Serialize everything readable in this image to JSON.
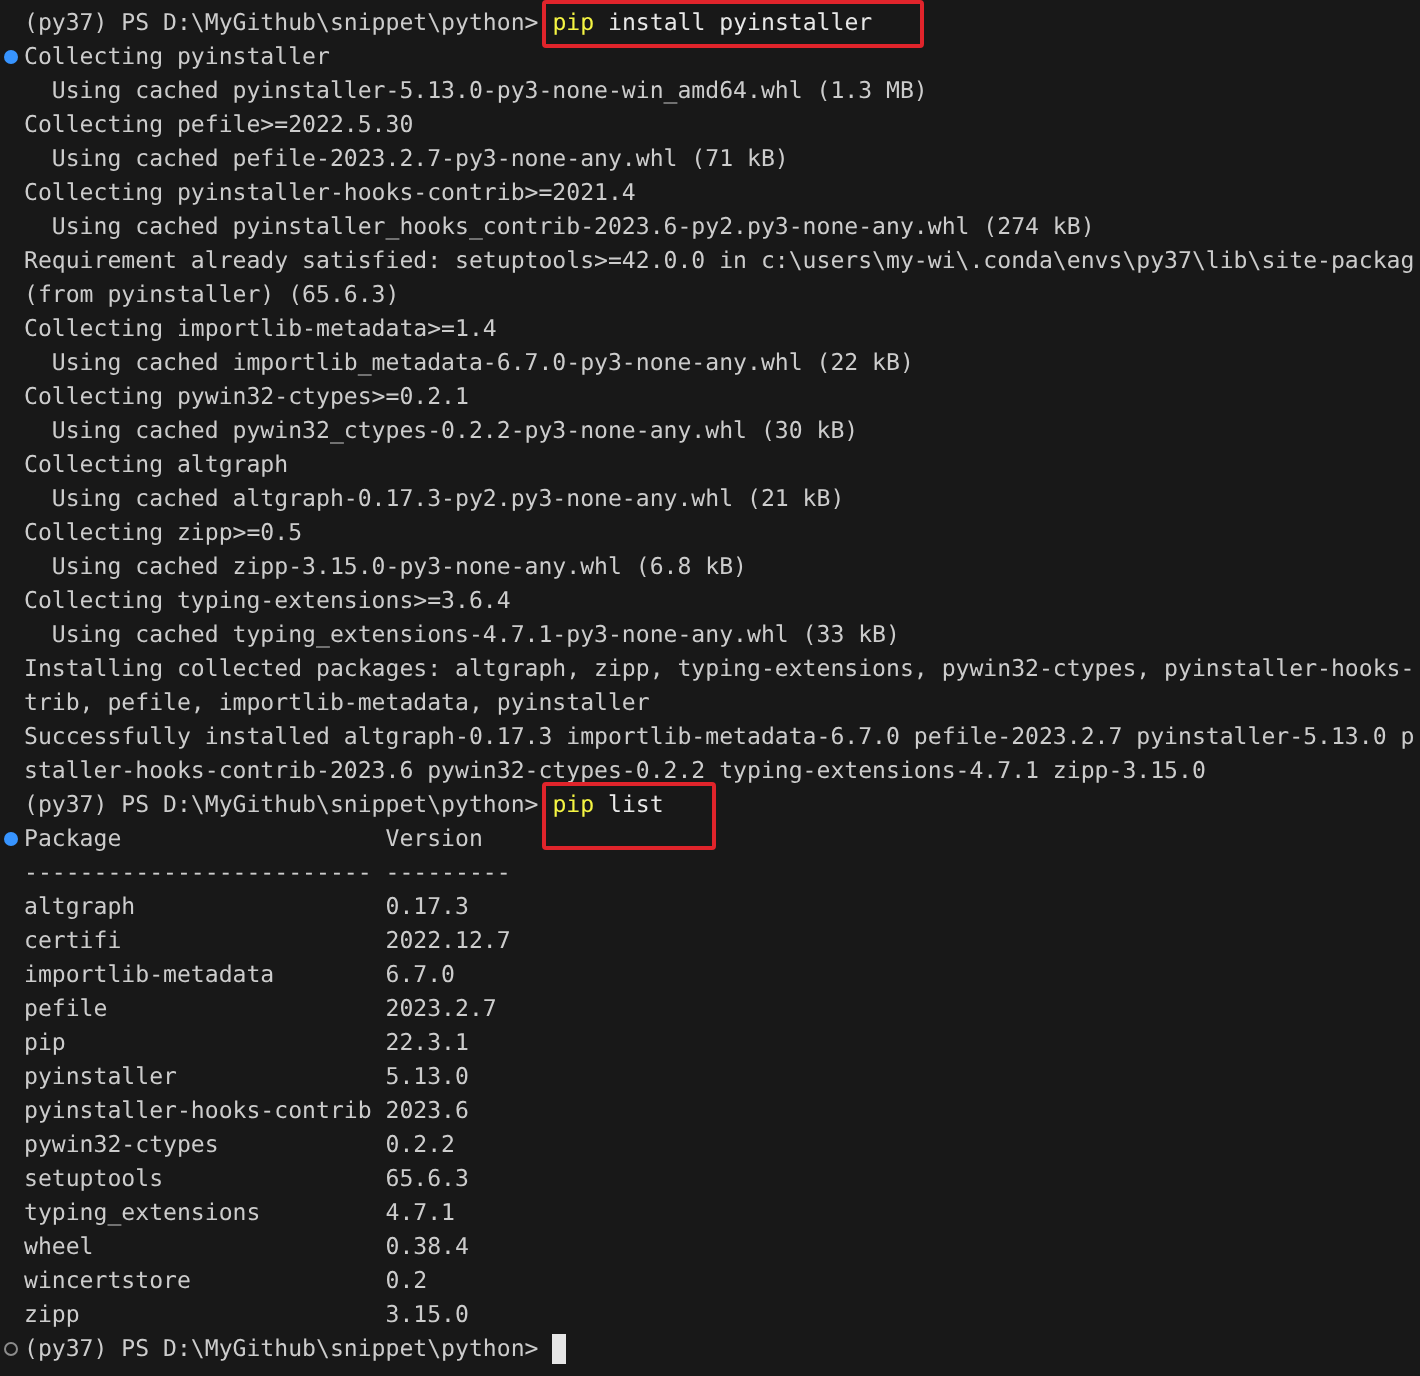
{
  "terminal": {
    "lines": [
      {
        "kind": "prompt",
        "prompt": "(py37) PS D:\\MyGithub\\snippet\\python>",
        "command": "pip",
        "args": "install pyinstaller",
        "highlighted": true,
        "cursor": false
      },
      {
        "kind": "output",
        "text": "Collecting pyinstaller",
        "color": "#3794ff"
      },
      {
        "kind": "output",
        "text": "  Using cached pyinstaller-5.13.0-py3-none-win_amd64.whl (1.3 MB)"
      },
      {
        "kind": "output",
        "text": "Collecting pefile>=2022.5.30"
      },
      {
        "kind": "output",
        "text": "  Using cached pefile-2023.2.7-py3-none-any.whl (71 kB)"
      },
      {
        "kind": "output",
        "text": "Collecting pyinstaller-hooks-contrib>=2021.4"
      },
      {
        "kind": "output",
        "text": "  Using cached pyinstaller_hooks_contrib-2023.6-py2.py3-none-any.whl (274 kB)"
      },
      {
        "kind": "output",
        "text": "Requirement already satisfied: setuptools>=42.0.0 in c:\\users\\my-wi\\.conda\\envs\\py37\\lib\\site-packag"
      },
      {
        "kind": "output",
        "text": "(from pyinstaller) (65.6.3)"
      },
      {
        "kind": "output",
        "text": "Collecting importlib-metadata>=1.4"
      },
      {
        "kind": "output",
        "text": "  Using cached importlib_metadata-6.7.0-py3-none-any.whl (22 kB)"
      },
      {
        "kind": "output",
        "text": "Collecting pywin32-ctypes>=0.2.1"
      },
      {
        "kind": "output",
        "text": "  Using cached pywin32_ctypes-0.2.2-py3-none-any.whl (30 kB)"
      },
      {
        "kind": "output",
        "text": "Collecting altgraph"
      },
      {
        "kind": "output",
        "text": "  Using cached altgraph-0.17.3-py2.py3-none-any.whl (21 kB)"
      },
      {
        "kind": "output",
        "text": "Collecting zipp>=0.5"
      },
      {
        "kind": "output",
        "text": "  Using cached zipp-3.15.0-py3-none-any.whl (6.8 kB)"
      },
      {
        "kind": "output",
        "text": "Collecting typing-extensions>=3.6.4"
      },
      {
        "kind": "output",
        "text": "  Using cached typing_extensions-4.7.1-py3-none-any.whl (33 kB)"
      },
      {
        "kind": "output",
        "text": "Installing collected packages: altgraph, zipp, typing-extensions, pywin32-ctypes, pyinstaller-hooks-"
      },
      {
        "kind": "output",
        "text": "trib, pefile, importlib-metadata, pyinstaller"
      },
      {
        "kind": "output",
        "text": "Successfully installed altgraph-0.17.3 importlib-metadata-6.7.0 pefile-2023.2.7 pyinstaller-5.13.0 p"
      },
      {
        "kind": "output",
        "text": "staller-hooks-contrib-2023.6 pywin32-ctypes-0.2.2 typing-extensions-4.7.1 zipp-3.15.0"
      },
      {
        "kind": "prompt",
        "prompt": "(py37) PS D:\\MyGithub\\snippet\\python>",
        "command": "pip",
        "args": "list",
        "highlighted": true,
        "cursor": false
      },
      {
        "kind": "output",
        "text": "Package                   Version",
        "color": "#3794ff"
      },
      {
        "kind": "output",
        "text": "------------------------- ---------"
      },
      {
        "kind": "output",
        "text": "altgraph                  0.17.3"
      },
      {
        "kind": "output",
        "text": "certifi                   2022.12.7"
      },
      {
        "kind": "output",
        "text": "importlib-metadata        6.7.0"
      },
      {
        "kind": "output",
        "text": "pefile                    2023.2.7"
      },
      {
        "kind": "output",
        "text": "pip                       22.3.1"
      },
      {
        "kind": "output",
        "text": "pyinstaller               5.13.0"
      },
      {
        "kind": "output",
        "text": "pyinstaller-hooks-contrib 2023.6"
      },
      {
        "kind": "output",
        "text": "pywin32-ctypes            0.2.2"
      },
      {
        "kind": "output",
        "text": "setuptools                65.6.3"
      },
      {
        "kind": "output",
        "text": "typing_extensions         4.7.1"
      },
      {
        "kind": "output",
        "text": "wheel                     0.38.4"
      },
      {
        "kind": "output",
        "text": "wincertstore              0.2"
      },
      {
        "kind": "output",
        "text": "zipp                      3.15.0"
      },
      {
        "kind": "prompt",
        "prompt": "(py37) PS D:\\MyGithub\\snippet\\python>",
        "highlighted": false,
        "cursor": true,
        "color": "#8c8c8c"
      }
    ]
  }
}
